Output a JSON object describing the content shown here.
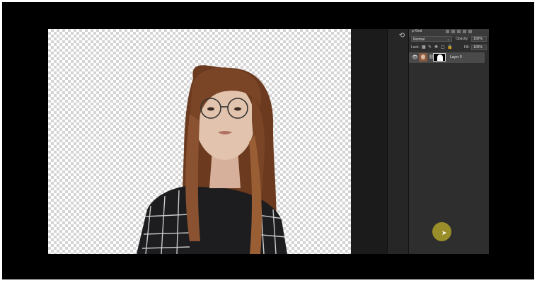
{
  "layers_panel": {
    "filter_label": "ρ Kind",
    "blend_mode": "Normal",
    "opacity_label": "Opacity:",
    "opacity_value": "100%",
    "lock_label": "Lock:",
    "fill_label": "Fill:",
    "fill_value": "100%",
    "layers": [
      {
        "name": "Layer 0",
        "visible": true
      }
    ]
  },
  "icons": {
    "panel_tool": "history-icon",
    "eye": "eye-icon",
    "chain": "link-icon",
    "cursor": "pointer-icon"
  },
  "colors": {
    "background": "#000000",
    "panel": "#2e2e2e",
    "selected_layer": "#4a4a4a",
    "cursor_highlight": "#bea828"
  }
}
